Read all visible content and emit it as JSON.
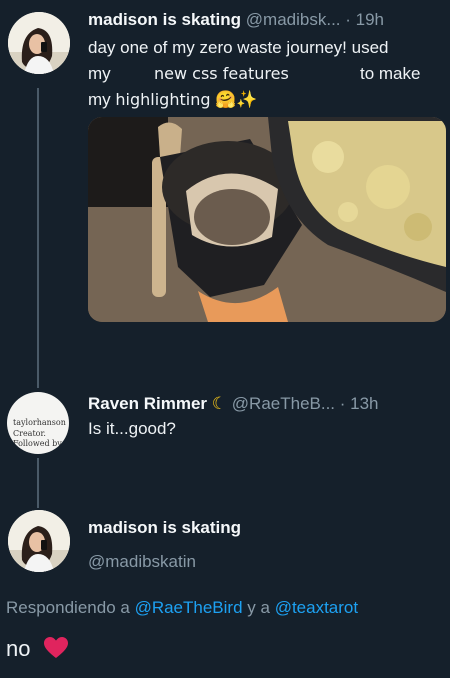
{
  "tweet1": {
    "name": "madison is skating",
    "handle": "@madibsk...",
    "time": "· 19h",
    "line1": "day one of my zero waste journey! used",
    "line2_a": "my",
    "line2_b": "new css features",
    "line2_c": "to make",
    "line3_a": "my",
    "line3_b": "highlighting",
    "emoji": "🤗✨"
  },
  "tweet2": {
    "name": "Raven Rimmer",
    "moon": "☾",
    "handle": "@RaeTheB...",
    "time": "· 13h",
    "text": "Is it...good?",
    "avatar_lines": [
      "taylorhanson",
      "Creator.",
      "Followed by",
      "…"
    ]
  },
  "tweet3": {
    "name": "madison is skating",
    "handle": "@madibskatin",
    "reply_prefix": "Respondiendo a",
    "reply_user1": "@RaeTheBird",
    "reply_join": "y a",
    "reply_user2": "@teaxtarot",
    "text": "no",
    "heart_color": "#e0245e"
  },
  "colors": {
    "background": "#15202b",
    "link": "#1da1f2",
    "muted": "#8899a6"
  }
}
